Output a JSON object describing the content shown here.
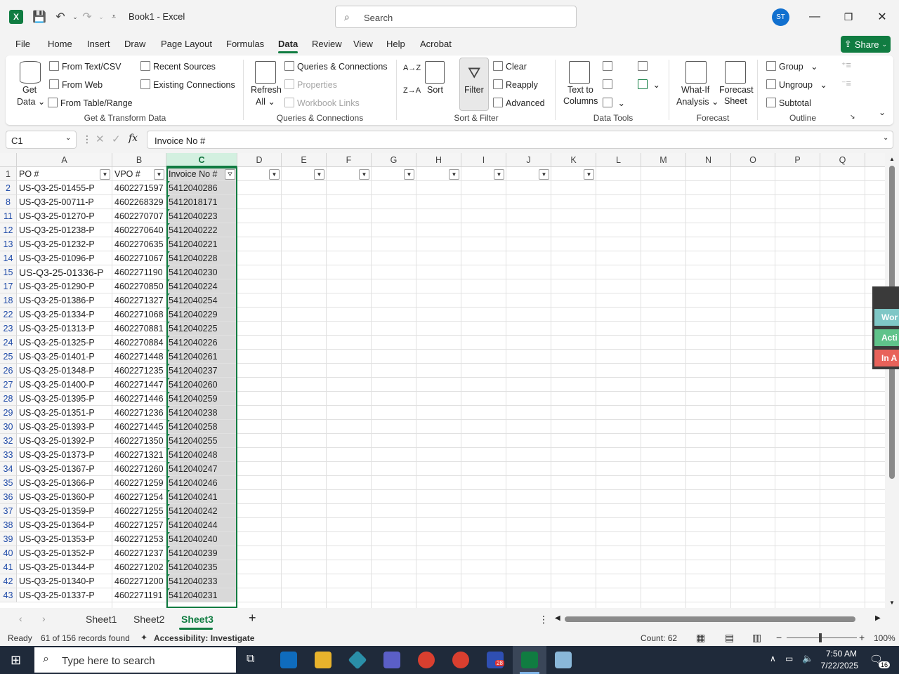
{
  "title": "Book1  -  Excel",
  "search_placeholder": "Search",
  "avatar_initials": "ST",
  "share_label": "Share",
  "tabs": [
    "File",
    "Home",
    "Insert",
    "Draw",
    "Page Layout",
    "Formulas",
    "Data",
    "Review",
    "View",
    "Help",
    "Acrobat"
  ],
  "active_tab": "Data",
  "ribbon": {
    "get_data": [
      "Get",
      "Data"
    ],
    "from_text_csv": "From Text/CSV",
    "from_web": "From Web",
    "from_table_range": "From Table/Range",
    "recent_sources": "Recent Sources",
    "existing_connections": "Existing Connections",
    "group_get_transform": "Get & Transform Data",
    "refresh_all": [
      "Refresh",
      "All"
    ],
    "queries_connections": "Queries & Connections",
    "properties": "Properties",
    "workbook_links": "Workbook Links",
    "group_queries": "Queries & Connections",
    "sort_az": "A→Z",
    "sort_za": "Z→A",
    "sort": "Sort",
    "filter": "Filter",
    "clear": "Clear",
    "reapply": "Reapply",
    "advanced": "Advanced",
    "group_sort_filter": "Sort & Filter",
    "text_to_columns": [
      "Text to",
      "Columns"
    ],
    "group_data_tools": "Data Tools",
    "what_if": [
      "What-If",
      "Analysis"
    ],
    "forecast_sheet": [
      "Forecast",
      "Sheet"
    ],
    "group_forecast": "Forecast",
    "group": "Group",
    "ungroup": "Ungroup",
    "subtotal": "Subtotal",
    "group_outline": "Outline"
  },
  "name_box": "C1",
  "formula": "Invoice No #",
  "columns": [
    "A",
    "B",
    "C",
    "D",
    "E",
    "F",
    "G",
    "H",
    "I",
    "J",
    "K",
    "L",
    "M",
    "N",
    "O",
    "P",
    "Q"
  ],
  "header_row": {
    "row": "1",
    "a": "PO #",
    "b": "VPO #",
    "c": "Invoice No #"
  },
  "rows": [
    {
      "r": "2",
      "a": "US-Q3-25-01455-P",
      "b": "4602271597",
      "c": "5412040286"
    },
    {
      "r": "8",
      "a": "US-Q3-25-00711-P",
      "b": "4602268329",
      "c": "5412018171"
    },
    {
      "r": "11",
      "a": "US-Q3-25-01270-P",
      "b": "4602270707",
      "c": "5412040223"
    },
    {
      "r": "12",
      "a": "US-Q3-25-01238-P",
      "b": "4602270640",
      "c": "5412040222"
    },
    {
      "r": "13",
      "a": "US-Q3-25-01232-P",
      "b": "4602270635",
      "c": "5412040221"
    },
    {
      "r": "14",
      "a": "US-Q3-25-01096-P",
      "b": "4602271067",
      "c": "5412040228"
    },
    {
      "r": "15",
      "a": "US-Q3-25-01336-P",
      "b": "4602271190",
      "c": "5412040230"
    },
    {
      "r": "17",
      "a": "US-Q3-25-01290-P",
      "b": "4602270850",
      "c": "5412040224"
    },
    {
      "r": "18",
      "a": "US-Q3-25-01386-P",
      "b": "4602271327",
      "c": "5412040254"
    },
    {
      "r": "22",
      "a": "US-Q3-25-01334-P",
      "b": "4602271068",
      "c": "5412040229"
    },
    {
      "r": "23",
      "a": "US-Q3-25-01313-P",
      "b": "4602270881",
      "c": "5412040225"
    },
    {
      "r": "24",
      "a": "US-Q3-25-01325-P",
      "b": "4602270884",
      "c": "5412040226"
    },
    {
      "r": "25",
      "a": "US-Q3-25-01401-P",
      "b": "4602271448",
      "c": "5412040261"
    },
    {
      "r": "26",
      "a": "US-Q3-25-01348-P",
      "b": "4602271235",
      "c": "5412040237"
    },
    {
      "r": "27",
      "a": "US-Q3-25-01400-P",
      "b": "4602271447",
      "c": "5412040260"
    },
    {
      "r": "28",
      "a": "US-Q3-25-01395-P",
      "b": "4602271446",
      "c": "5412040259"
    },
    {
      "r": "29",
      "a": "US-Q3-25-01351-P",
      "b": "4602271236",
      "c": "5412040238"
    },
    {
      "r": "30",
      "a": "US-Q3-25-01393-P",
      "b": "4602271445",
      "c": "5412040258"
    },
    {
      "r": "32",
      "a": "US-Q3-25-01392-P",
      "b": "4602271350",
      "c": "5412040255"
    },
    {
      "r": "33",
      "a": "US-Q3-25-01373-P",
      "b": "4602271321",
      "c": "5412040248"
    },
    {
      "r": "34",
      "a": "US-Q3-25-01367-P",
      "b": "4602271260",
      "c": "5412040247"
    },
    {
      "r": "35",
      "a": "US-Q3-25-01366-P",
      "b": "4602271259",
      "c": "5412040246"
    },
    {
      "r": "36",
      "a": "US-Q3-25-01360-P",
      "b": "4602271254",
      "c": "5412040241"
    },
    {
      "r": "37",
      "a": "US-Q3-25-01359-P",
      "b": "4602271255",
      "c": "5412040242"
    },
    {
      "r": "38",
      "a": "US-Q3-25-01364-P",
      "b": "4602271257",
      "c": "5412040244"
    },
    {
      "r": "39",
      "a": "US-Q3-25-01353-P",
      "b": "4602271253",
      "c": "5412040240"
    },
    {
      "r": "40",
      "a": "US-Q3-25-01352-P",
      "b": "4602271237",
      "c": "5412040239"
    },
    {
      "r": "41",
      "a": "US-Q3-25-01344-P",
      "b": "4602271202",
      "c": "5412040235"
    },
    {
      "r": "42",
      "a": "US-Q3-25-01340-P",
      "b": "4602271200",
      "c": "5412040233"
    },
    {
      "r": "43",
      "a": "US-Q3-25-01337-P",
      "b": "4602271191",
      "c": "5412040231"
    }
  ],
  "side_panel": [
    "Wor",
    "Acti",
    "In A"
  ],
  "sheets": [
    "Sheet1",
    "Sheet2",
    "Sheet3"
  ],
  "active_sheet": "Sheet3",
  "status": {
    "ready": "Ready",
    "records": "61 of 156 records found",
    "accessibility": "Accessibility: Investigate",
    "count": "Count: 62",
    "zoom": "100%"
  },
  "taskbar": {
    "search_placeholder": "Type here to search",
    "time": "7:50 AM",
    "date": "7/22/2025",
    "notification_count": "16",
    "zoom_badge": "28"
  }
}
